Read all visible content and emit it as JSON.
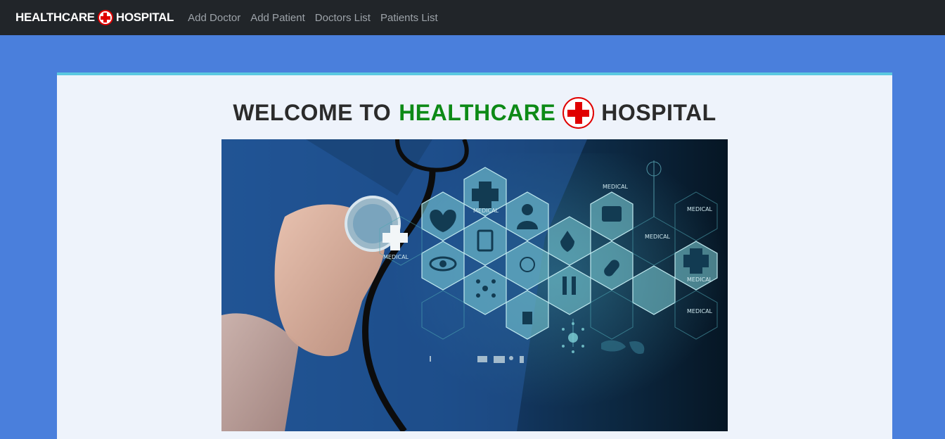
{
  "navbar": {
    "brand_left": "HEALTHCARE",
    "brand_right": "HOSPITAL",
    "brand_icon": "red-cross-icon",
    "links": [
      {
        "label": "Add Doctor"
      },
      {
        "label": "Add Patient"
      },
      {
        "label": "Doctors List"
      },
      {
        "label": "Patients List"
      }
    ]
  },
  "welcome": {
    "prefix": "WELCOME TO",
    "highlight": "HEALTHCARE",
    "suffix": "HOSPITAL"
  },
  "hero": {
    "label_medical": "MEDICAL"
  },
  "colors": {
    "navbar_bg": "#212529",
    "page_bg": "#4a7fdc",
    "panel_bg": "#eef3fb",
    "panel_top_border": "#5bc8e0",
    "highlight_green": "#0d8a16",
    "cross_red": "#e00000"
  }
}
